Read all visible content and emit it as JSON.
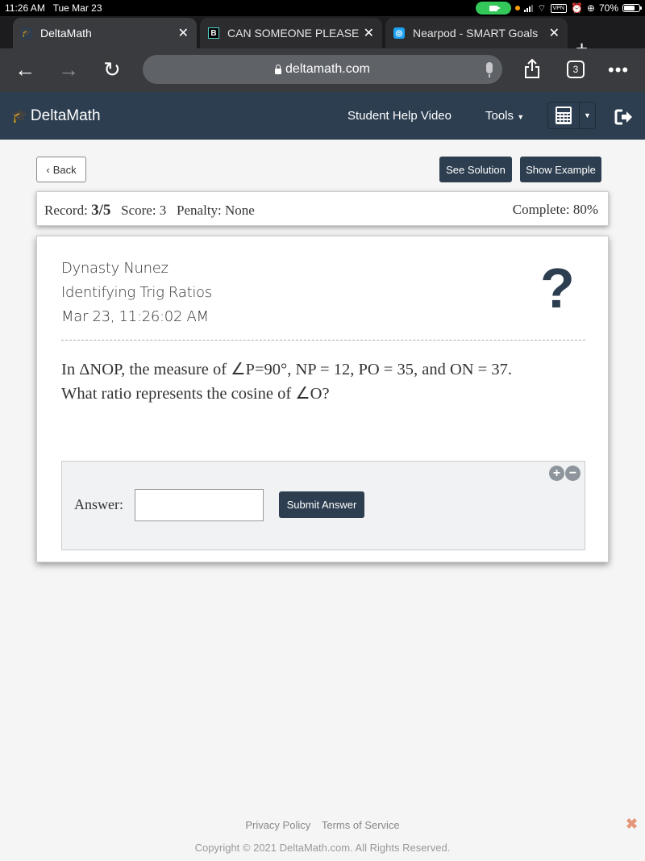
{
  "status_bar": {
    "time": "11:26 AM",
    "date": "Tue Mar 23",
    "battery": "70%",
    "vpn_label": "VPN"
  },
  "browser": {
    "tabs": [
      {
        "title": "DeltaMath",
        "icon": "graduation-cap-icon",
        "active": true
      },
      {
        "title": "CAN SOMEONE PLEASE I",
        "icon": "brainly-icon",
        "active": false
      },
      {
        "title": "Nearpod - SMART Goals",
        "icon": "nearpod-icon",
        "active": false
      }
    ],
    "url": "deltamath.com",
    "tab_count": "3"
  },
  "header": {
    "brand": "DeltaMath",
    "nav": {
      "help_video": "Student Help Video",
      "tools": "Tools"
    }
  },
  "toolbar": {
    "back": "Back",
    "see_solution": "See Solution",
    "show_example": "Show Example"
  },
  "record": {
    "record_label": "Record:",
    "record_value": "3/5",
    "score": "Score: 3",
    "penalty": "Penalty: None",
    "complete": "Complete: 80%"
  },
  "problem": {
    "student": "Dynasty Nunez",
    "topic": "Identifying Trig Ratios",
    "timestamp": "Mar 23, 11:26:02 AM",
    "help_symbol": "?",
    "question_line1": "In ΔNOP, the measure of ∠P=90°, NP = 12, PO = 35, and ON = 37.",
    "question_line2": "What ratio represents the cosine of ∠O?",
    "answer_label": "Answer:",
    "answer_value": "",
    "submit": "Submit Answer"
  },
  "footer": {
    "privacy": "Privacy Policy",
    "terms": "Terms of Service",
    "copyright": "Copyright © 2021 DeltaMath.com. All Rights Reserved."
  },
  "colors": {
    "brand_navy": "#2d3e50",
    "footer_close": "#e6967a"
  }
}
